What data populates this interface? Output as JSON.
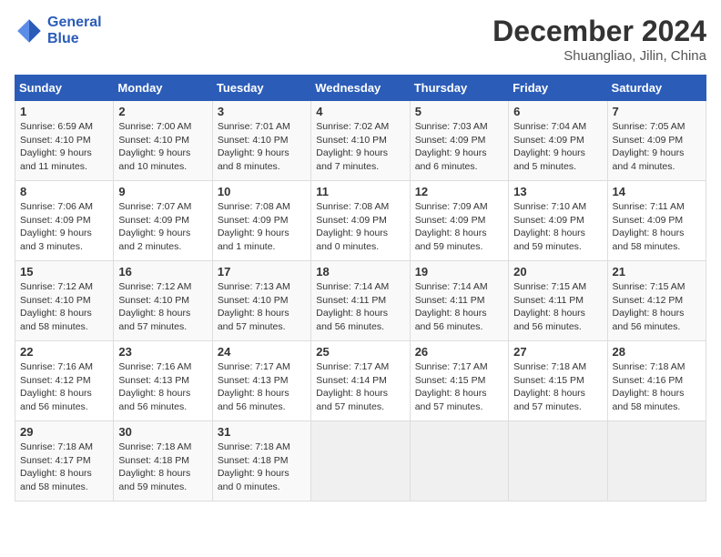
{
  "header": {
    "logo_line1": "General",
    "logo_line2": "Blue",
    "month": "December 2024",
    "location": "Shuangliao, Jilin, China"
  },
  "days_of_week": [
    "Sunday",
    "Monday",
    "Tuesday",
    "Wednesday",
    "Thursday",
    "Friday",
    "Saturday"
  ],
  "weeks": [
    [
      {
        "day": "1",
        "text": "Sunrise: 6:59 AM\nSunset: 4:10 PM\nDaylight: 9 hours and 11 minutes."
      },
      {
        "day": "2",
        "text": "Sunrise: 7:00 AM\nSunset: 4:10 PM\nDaylight: 9 hours and 10 minutes."
      },
      {
        "day": "3",
        "text": "Sunrise: 7:01 AM\nSunset: 4:10 PM\nDaylight: 9 hours and 8 minutes."
      },
      {
        "day": "4",
        "text": "Sunrise: 7:02 AM\nSunset: 4:10 PM\nDaylight: 9 hours and 7 minutes."
      },
      {
        "day": "5",
        "text": "Sunrise: 7:03 AM\nSunset: 4:09 PM\nDaylight: 9 hours and 6 minutes."
      },
      {
        "day": "6",
        "text": "Sunrise: 7:04 AM\nSunset: 4:09 PM\nDaylight: 9 hours and 5 minutes."
      },
      {
        "day": "7",
        "text": "Sunrise: 7:05 AM\nSunset: 4:09 PM\nDaylight: 9 hours and 4 minutes."
      }
    ],
    [
      {
        "day": "8",
        "text": "Sunrise: 7:06 AM\nSunset: 4:09 PM\nDaylight: 9 hours and 3 minutes."
      },
      {
        "day": "9",
        "text": "Sunrise: 7:07 AM\nSunset: 4:09 PM\nDaylight: 9 hours and 2 minutes."
      },
      {
        "day": "10",
        "text": "Sunrise: 7:08 AM\nSunset: 4:09 PM\nDaylight: 9 hours and 1 minute."
      },
      {
        "day": "11",
        "text": "Sunrise: 7:08 AM\nSunset: 4:09 PM\nDaylight: 9 hours and 0 minutes."
      },
      {
        "day": "12",
        "text": "Sunrise: 7:09 AM\nSunset: 4:09 PM\nDaylight: 8 hours and 59 minutes."
      },
      {
        "day": "13",
        "text": "Sunrise: 7:10 AM\nSunset: 4:09 PM\nDaylight: 8 hours and 59 minutes."
      },
      {
        "day": "14",
        "text": "Sunrise: 7:11 AM\nSunset: 4:09 PM\nDaylight: 8 hours and 58 minutes."
      }
    ],
    [
      {
        "day": "15",
        "text": "Sunrise: 7:12 AM\nSunset: 4:10 PM\nDaylight: 8 hours and 58 minutes."
      },
      {
        "day": "16",
        "text": "Sunrise: 7:12 AM\nSunset: 4:10 PM\nDaylight: 8 hours and 57 minutes."
      },
      {
        "day": "17",
        "text": "Sunrise: 7:13 AM\nSunset: 4:10 PM\nDaylight: 8 hours and 57 minutes."
      },
      {
        "day": "18",
        "text": "Sunrise: 7:14 AM\nSunset: 4:11 PM\nDaylight: 8 hours and 56 minutes."
      },
      {
        "day": "19",
        "text": "Sunrise: 7:14 AM\nSunset: 4:11 PM\nDaylight: 8 hours and 56 minutes."
      },
      {
        "day": "20",
        "text": "Sunrise: 7:15 AM\nSunset: 4:11 PM\nDaylight: 8 hours and 56 minutes."
      },
      {
        "day": "21",
        "text": "Sunrise: 7:15 AM\nSunset: 4:12 PM\nDaylight: 8 hours and 56 minutes."
      }
    ],
    [
      {
        "day": "22",
        "text": "Sunrise: 7:16 AM\nSunset: 4:12 PM\nDaylight: 8 hours and 56 minutes."
      },
      {
        "day": "23",
        "text": "Sunrise: 7:16 AM\nSunset: 4:13 PM\nDaylight: 8 hours and 56 minutes."
      },
      {
        "day": "24",
        "text": "Sunrise: 7:17 AM\nSunset: 4:13 PM\nDaylight: 8 hours and 56 minutes."
      },
      {
        "day": "25",
        "text": "Sunrise: 7:17 AM\nSunset: 4:14 PM\nDaylight: 8 hours and 57 minutes."
      },
      {
        "day": "26",
        "text": "Sunrise: 7:17 AM\nSunset: 4:15 PM\nDaylight: 8 hours and 57 minutes."
      },
      {
        "day": "27",
        "text": "Sunrise: 7:18 AM\nSunset: 4:15 PM\nDaylight: 8 hours and 57 minutes."
      },
      {
        "day": "28",
        "text": "Sunrise: 7:18 AM\nSunset: 4:16 PM\nDaylight: 8 hours and 58 minutes."
      }
    ],
    [
      {
        "day": "29",
        "text": "Sunrise: 7:18 AM\nSunset: 4:17 PM\nDaylight: 8 hours and 58 minutes."
      },
      {
        "day": "30",
        "text": "Sunrise: 7:18 AM\nSunset: 4:18 PM\nDaylight: 8 hours and 59 minutes."
      },
      {
        "day": "31",
        "text": "Sunrise: 7:18 AM\nSunset: 4:18 PM\nDaylight: 9 hours and 0 minutes."
      },
      {
        "day": "",
        "text": ""
      },
      {
        "day": "",
        "text": ""
      },
      {
        "day": "",
        "text": ""
      },
      {
        "day": "",
        "text": ""
      }
    ]
  ]
}
